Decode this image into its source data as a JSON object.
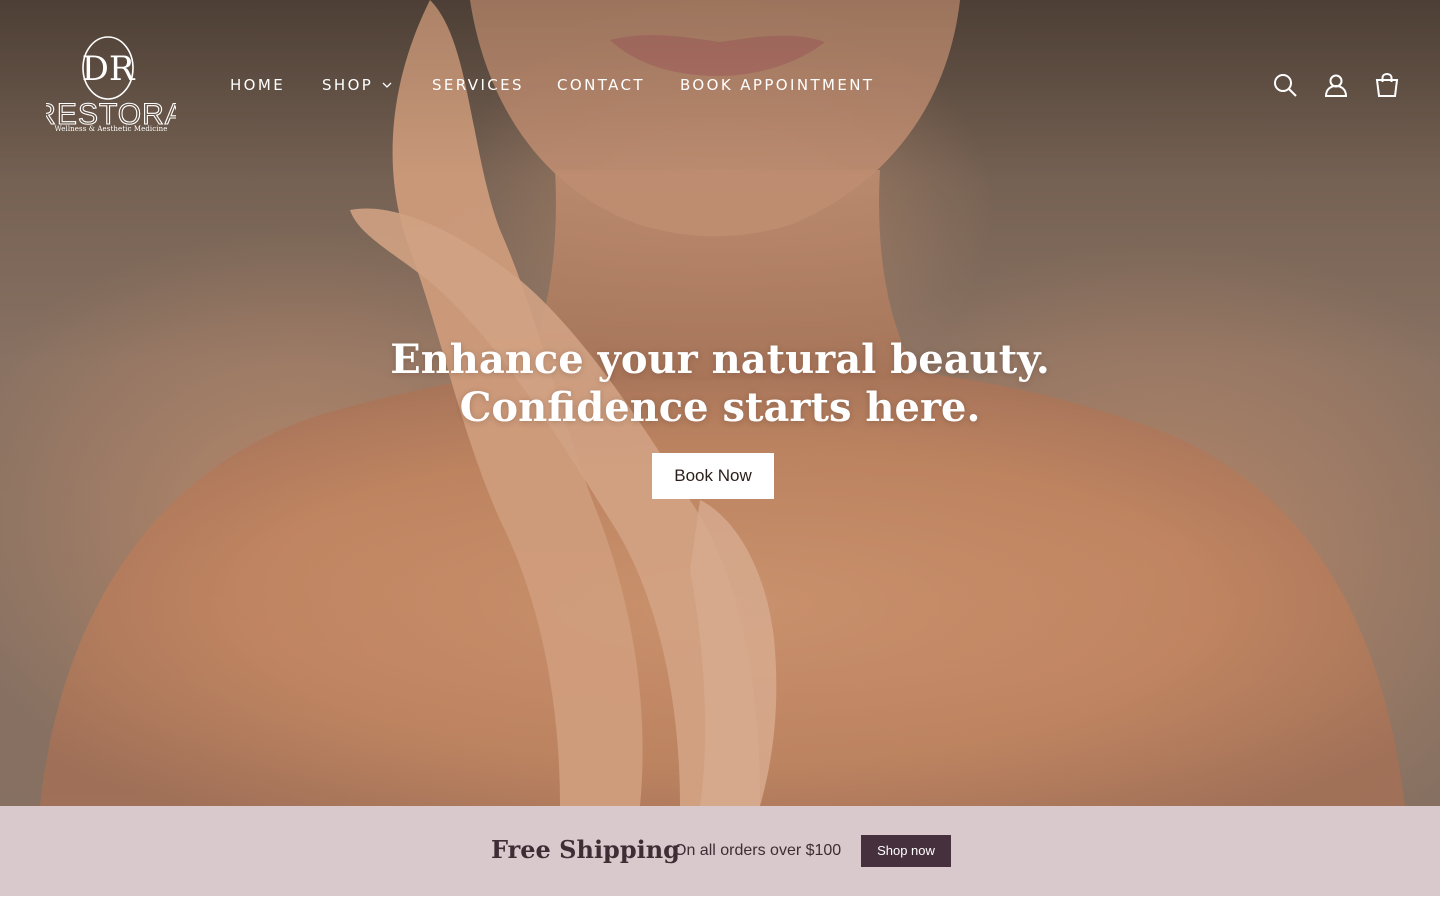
{
  "header": {
    "logo": {
      "monogram": "DR",
      "wordmark": "RESTORA",
      "tagline": "Wellness & Aesthetic Medicine"
    },
    "nav": [
      {
        "label": "HOME"
      },
      {
        "label": "SHOP",
        "has_dropdown": true
      },
      {
        "label": "SERVICES"
      },
      {
        "label": "CONTACT"
      },
      {
        "label": "BOOK APPOINTMENT"
      }
    ],
    "icons": [
      "search-icon",
      "account-icon",
      "cart-icon"
    ]
  },
  "hero": {
    "heading_line1": "Enhance your natural beauty.",
    "heading_line2": "Confidence starts here.",
    "cta_label": "Book Now"
  },
  "promo": {
    "title": "Free Shipping",
    "text": "On all orders over $100",
    "button_label": "Shop now"
  },
  "colors": {
    "promo_background": "#d9c9cc",
    "promo_text": "#3d2e35",
    "promo_button": "#46303d",
    "hero_text": "#ffffff"
  }
}
